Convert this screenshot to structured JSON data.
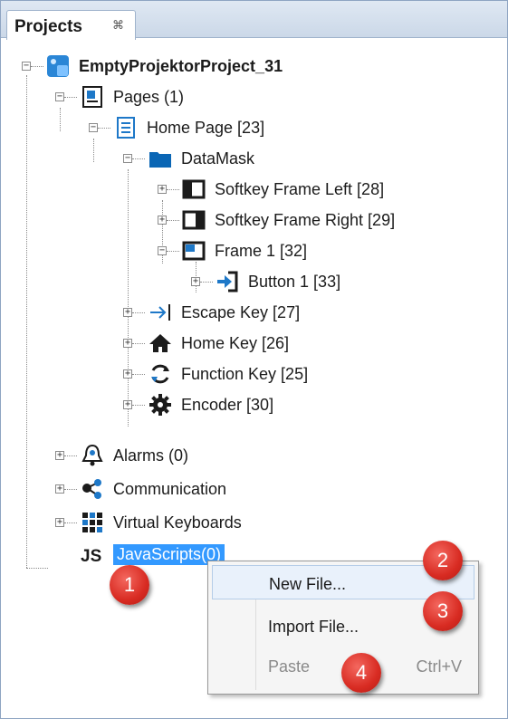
{
  "panel": {
    "tab_title": "Projects",
    "tab_close": "⌘"
  },
  "tree": {
    "root": "EmptyProjektorProject_31",
    "pages": "Pages (1)",
    "home_page": "Home Page [23]",
    "datamask": "DataMask",
    "softkey_left": "Softkey Frame Left [28]",
    "softkey_right": "Softkey Frame Right [29]",
    "frame1": "Frame 1 [32]",
    "button1": "Button 1 [33]",
    "escape_key": "Escape Key [27]",
    "home_key": "Home Key [26]",
    "function_key": "Function Key [25]",
    "encoder": "Encoder [30]",
    "alarms": "Alarms (0)",
    "communication": "Communication",
    "virtual_keyboards": "Virtual Keyboards",
    "javascripts": "JavaScripts(0)"
  },
  "context_menu": {
    "new_file": "New File...",
    "import_file": "Import File...",
    "paste": "Paste",
    "paste_shortcut": "Ctrl+V"
  },
  "callouts": [
    "1",
    "2",
    "3",
    "4"
  ],
  "colors": {
    "selection": "#3399ff",
    "badge": "#d82b22",
    "icon_blue": "#1e78c8"
  }
}
